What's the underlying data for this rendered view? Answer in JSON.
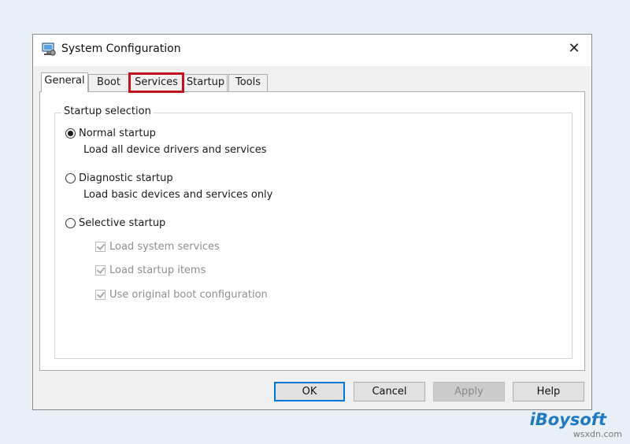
{
  "window": {
    "title": "System Configuration",
    "close_glyph": "✕",
    "icon": "system-config-icon"
  },
  "tabs": [
    {
      "label": "General",
      "active": true
    },
    {
      "label": "Boot",
      "active": false
    },
    {
      "label": "Services",
      "active": false,
      "highlighted": true
    },
    {
      "label": "Startup",
      "active": false
    },
    {
      "label": "Tools",
      "active": false
    }
  ],
  "startup_selection": {
    "group_label": "Startup selection",
    "options": [
      {
        "label": "Normal startup",
        "description": "Load all device drivers and services",
        "selected": true
      },
      {
        "label": "Diagnostic startup",
        "description": "Load basic devices and services only",
        "selected": false
      },
      {
        "label": "Selective startup",
        "selected": false
      }
    ],
    "selective_items": [
      {
        "label": "Load system services",
        "checked": true,
        "enabled": false
      },
      {
        "label": "Load startup items",
        "checked": true,
        "enabled": false
      },
      {
        "label": "Use original boot configuration",
        "checked": true,
        "enabled": false
      }
    ]
  },
  "buttons": {
    "ok": "OK",
    "cancel": "Cancel",
    "apply": "Apply",
    "help": "Help"
  },
  "branding": {
    "logo_text": "iBoysoft",
    "watermark": "wsxdn.com"
  },
  "colors": {
    "highlight": "#c1121f",
    "primary_border": "#0078d7",
    "brand": "#1f7ac1"
  }
}
